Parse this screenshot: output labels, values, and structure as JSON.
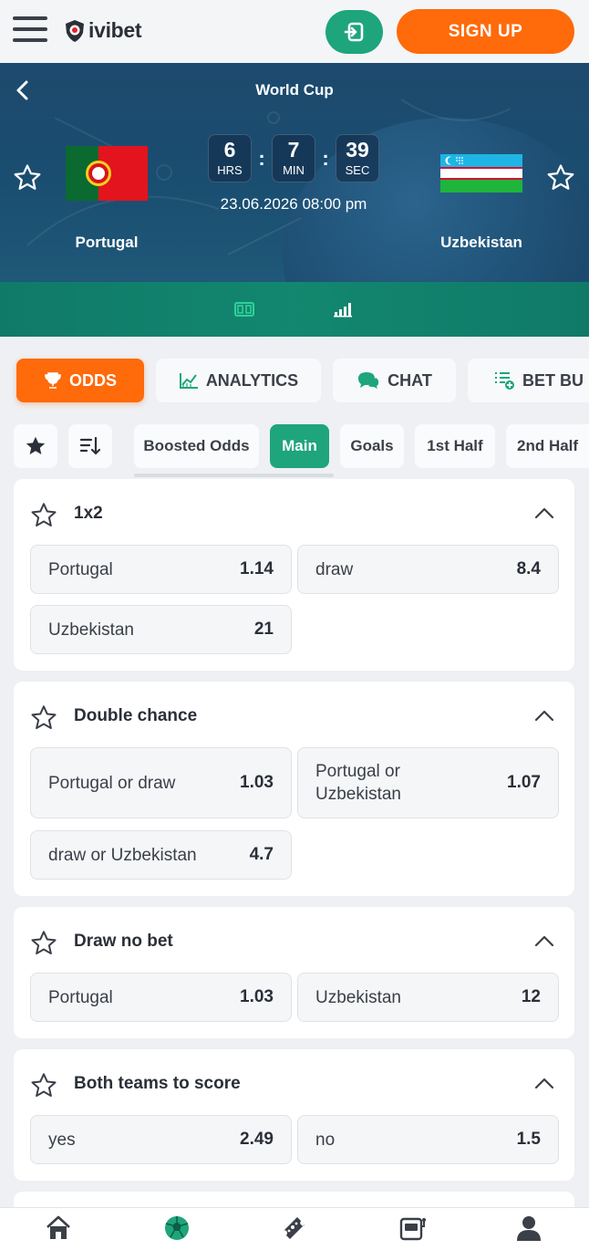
{
  "header": {
    "logo_text": "ivibet",
    "signup_label": "SIGN UP"
  },
  "match": {
    "tournament": "World Cup",
    "home_team": "Portugal",
    "away_team": "Uzbekistan",
    "countdown": [
      {
        "value": "6",
        "unit": "HRS"
      },
      {
        "value": "7",
        "unit": "MIN"
      },
      {
        "value": "39",
        "unit": "SEC"
      }
    ],
    "separator": ":",
    "date": "23.06.2026 08:00 pm"
  },
  "tabs": [
    {
      "label": "ODDS",
      "icon": "trophy-icon",
      "active": true
    },
    {
      "label": "ANALYTICS",
      "icon": "chart-line-icon",
      "active": false
    },
    {
      "label": "CHAT",
      "icon": "chat-icon",
      "active": false
    },
    {
      "label": "BET BU",
      "icon": "bet-builder-icon",
      "active": false
    }
  ],
  "filters": [
    "Boosted Odds",
    "Main",
    "Goals",
    "1st Half",
    "2nd Half"
  ],
  "markets": [
    {
      "title": "1x2",
      "odds": [
        {
          "label": "Portugal",
          "value": "1.14"
        },
        {
          "label": "draw",
          "value": "8.4"
        },
        {
          "label": "Uzbekistan",
          "value": "21"
        }
      ]
    },
    {
      "title": "Double chance",
      "odds": [
        {
          "label": "Portugal or draw",
          "value": "1.03"
        },
        {
          "label": "Portugal or Uzbekistan",
          "value": "1.07"
        },
        {
          "label": "draw or Uzbekistan",
          "value": "4.7"
        }
      ]
    },
    {
      "title": "Draw no bet",
      "odds": [
        {
          "label": "Portugal",
          "value": "1.03"
        },
        {
          "label": "Uzbekistan",
          "value": "12"
        }
      ]
    },
    {
      "title": "Both teams to score",
      "odds": [
        {
          "label": "yes",
          "value": "2.49"
        },
        {
          "label": "no",
          "value": "1.5"
        }
      ]
    }
  ],
  "bottom_nav": [
    "home-icon",
    "soccer-ball-icon",
    "ticket-icon",
    "slot-machine-icon",
    "profile-icon"
  ],
  "colors": {
    "accent_orange": "#ff6a0a",
    "accent_green": "#1ea57b",
    "hero_blue": "#1d4a6e",
    "subnav_teal": "#0f7a68"
  }
}
